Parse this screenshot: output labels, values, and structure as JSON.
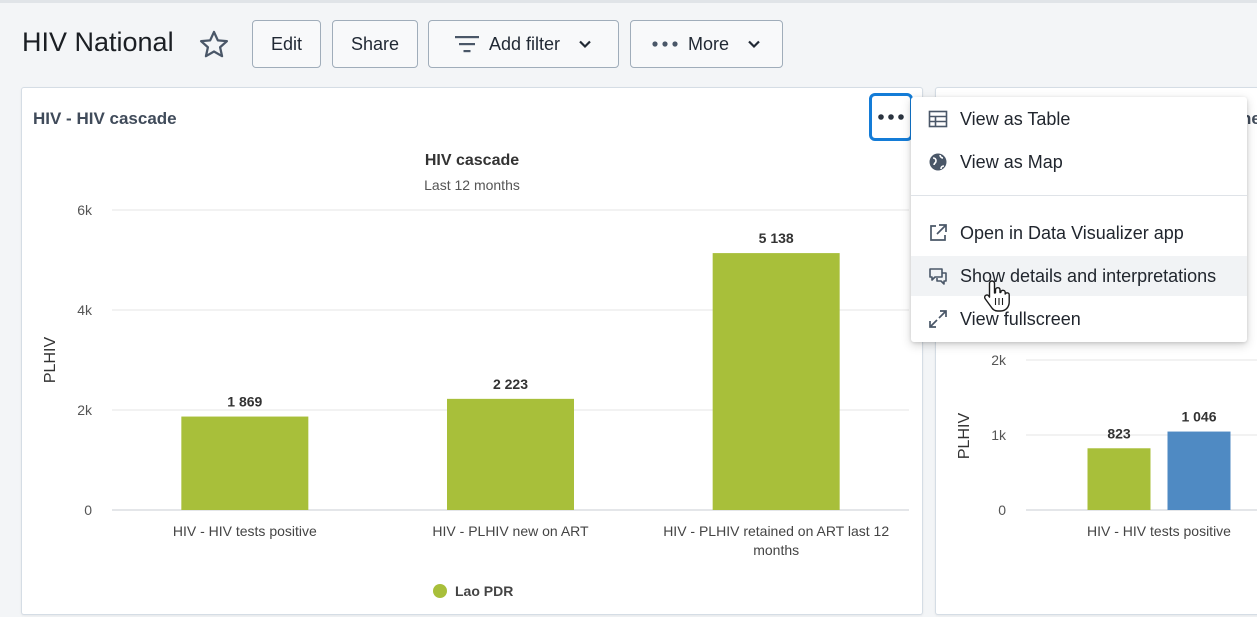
{
  "dashboard": {
    "title": "HIV National"
  },
  "toolbar": {
    "edit_label": "Edit",
    "share_label": "Share",
    "add_filter_label": "Add filter",
    "more_label": "More"
  },
  "item1": {
    "title": "HIV - HIV cascade",
    "chart_title": "HIV cascade",
    "chart_subtitle": "Last 12 months",
    "legend": "Lao PDR"
  },
  "item2": {
    "title_fragment": "ne"
  },
  "context_menu": {
    "items": [
      {
        "label": "View as Table",
        "icon": "table-icon"
      },
      {
        "label": "View as Map",
        "icon": "globe-icon"
      },
      {
        "label": "Open in Data Visualizer app",
        "icon": "external-link-icon"
      },
      {
        "label": "Show details and interpretations",
        "icon": "speech-bubbles-icon"
      },
      {
        "label": "View fullscreen",
        "icon": "fullscreen-icon"
      }
    ]
  },
  "colors": {
    "bar_green": "#a8bf3a",
    "bar_blue": "#4f8ac3",
    "accent_blue": "#147cd7"
  },
  "chart_data": [
    {
      "type": "bar",
      "title": "HIV cascade",
      "subtitle": "Last 12 months",
      "ylabel": "PLHIV",
      "xlabel": "",
      "ylim": [
        0,
        6000
      ],
      "yticks": [
        "0",
        "2k",
        "4k",
        "6k"
      ],
      "categories": [
        "HIV - HIV tests positive",
        "HIV - PLHIV new on ART",
        "HIV - PLHIV retained on ART last 12 months"
      ],
      "series": [
        {
          "name": "Lao PDR",
          "values": [
            1869,
            2223,
            5138
          ],
          "labels": [
            "1 869",
            "2 223",
            "5 138"
          ],
          "color": "#a8bf3a"
        }
      ],
      "legend": "bottom-center",
      "grid": true
    },
    {
      "type": "bar",
      "ylabel": "PLHIV",
      "yticks": [
        "0",
        "1k",
        "2k"
      ],
      "categories": [
        "HIV - HIV tests positive"
      ],
      "series": [
        {
          "values": [
            823
          ],
          "labels": [
            "823"
          ],
          "color": "#a8bf3a"
        },
        {
          "values": [
            1046
          ],
          "labels": [
            "1 046"
          ],
          "color": "#4f8ac3"
        }
      ],
      "grid": true
    }
  ]
}
